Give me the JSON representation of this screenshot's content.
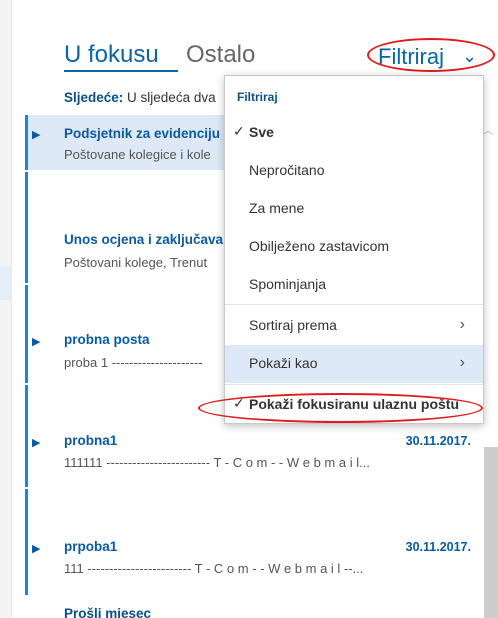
{
  "tabs": {
    "focused": "U fokusu",
    "other": "Ostalo"
  },
  "filter": {
    "label": "Filtriraj",
    "chevron_icon": "chevron-down-icon"
  },
  "next": {
    "label": "Sljedeće:",
    "text": "U sljedeća dva"
  },
  "messages": [
    {
      "sender": "Podsjetnik za evidenciju",
      "preview": "Poštovane kolegice i kole",
      "date": ""
    },
    {
      "sender": "Unos ocjena i zaključava",
      "preview": "Poštovani kolege, Trenut",
      "date": ""
    },
    {
      "sender": "probna posta",
      "preview": "proba 1 ---------------------",
      "date": ""
    },
    {
      "sender": "probna1",
      "preview": "111111 ------------------------ T - C o m - - W e b m a i l...",
      "date": "30.11.2017."
    },
    {
      "sender": "prpoba1",
      "preview": "111 ------------------------ T - C o m - - W e b m a i l --...",
      "date": "30.11.2017."
    }
  ],
  "section": {
    "previous_month": "Prošli miesec"
  },
  "dropdown": {
    "header": "Filtriraj",
    "items": [
      {
        "label": "Sve",
        "checked": true
      },
      {
        "label": "Nepročitano"
      },
      {
        "label": "Za mene"
      },
      {
        "label": "Obilježeno zastavicom"
      },
      {
        "label": "Spominjanja"
      },
      {
        "label": "Sortiraj prema",
        "submenu": true
      },
      {
        "label": "Pokaži kao",
        "submenu": true
      },
      {
        "label": "Pokaži fokusiranu ulaznu poštu",
        "checked": true
      }
    ]
  },
  "colors": {
    "accent": "#0a64a8",
    "annotation": "#e01b1b",
    "highlight": "#dde9f6"
  }
}
